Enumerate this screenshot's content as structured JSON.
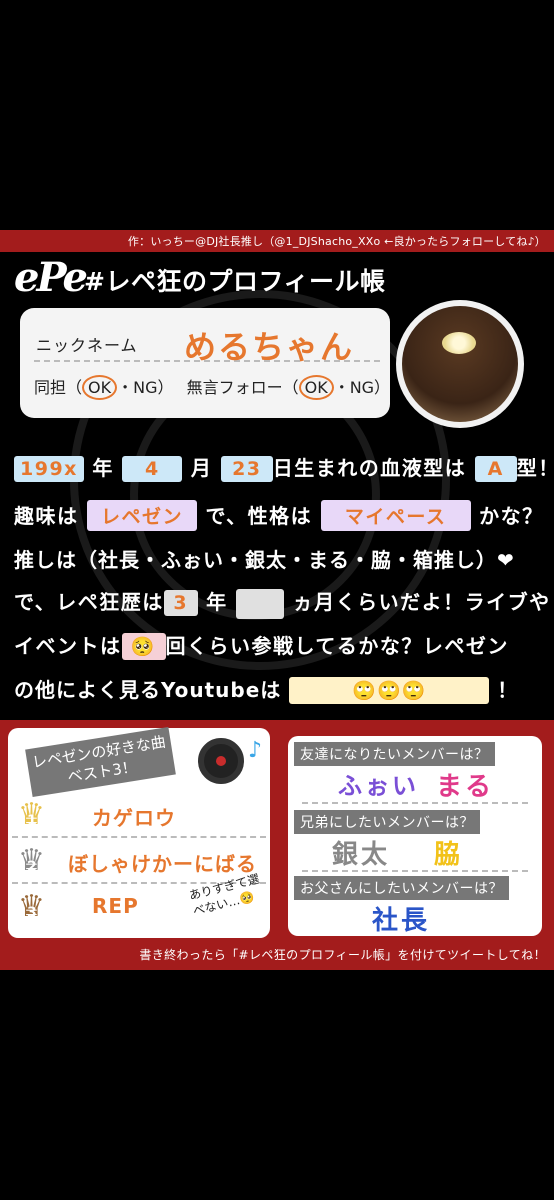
{
  "header": {
    "credit": "作：いっちー@DJ社長推し（@1_DJShacho_XXo ←良かったらフォローしてね♪）",
    "logo": "ePe",
    "title": "#レペ狂のプロフィール帳"
  },
  "profile": {
    "nickname_label": "ニックネーム",
    "nickname_value": "めるちゃん",
    "same_label": "同担（",
    "same_ok": "OK",
    "same_sep": "・NG）",
    "follow_label": "無言フォロー（",
    "follow_ok": "OK",
    "follow_sep": "・NG）"
  },
  "sentences": {
    "year": "199x",
    "year_suffix": "年",
    "month": "4",
    "month_suffix": "月",
    "day": "23",
    "day_suffix": "日生まれの血液型は",
    "blood": "A",
    "blood_suffix": "型！",
    "hobby_prefix": "趣味は",
    "hobby": "レペゼン",
    "hobby_mid": "で、性格は",
    "personality": "マイペース",
    "personality_suffix": "かな？",
    "oshi_line": "推しは（社長・ふぉい・銀太・まる・脇・箱推し）❤",
    "rp_prefix": "で、レペ狂歴は",
    "rp_years": "3",
    "rp_mid": "年",
    "rp_months": "",
    "rp_suffix": "ヵ月くらいだよ！ライブや",
    "event_prefix": "イベントは",
    "event_count": "🥺",
    "event_suffix": "回くらい参戦してるかな？レペゼン",
    "yt_prefix": "の他によく見るYoutubeは",
    "yt_value": "🙄🙄🙄",
    "yt_suffix": "！"
  },
  "best": {
    "tag": "レペゼンの好きな曲ベスト3！",
    "rank1": "1",
    "rank2": "2",
    "rank3": "3",
    "song1": "カゲロウ",
    "song2": "ぼしゃけかーにばる",
    "song3": "REP",
    "aside": "ありすぎて選べない…🥺"
  },
  "questions": {
    "q1": "友達になりたいメンバーは？",
    "a1a": "ふぉい",
    "a1b": "まる",
    "q2": "兄弟にしたいメンバーは？",
    "a2a": "銀太",
    "a2b": "脇",
    "q3": "お父さんにしたいメンバーは？",
    "a3": "社長"
  },
  "footer": "書き終わったら「#レペ狂のプロフィール帳」を付けてツイートしてね！",
  "colors": {
    "accent": "#e6772e",
    "red": "#a31c1c",
    "purple": "#7a4fd6",
    "pink": "#e03a8a",
    "blue": "#2a55c8",
    "grey": "#888888",
    "yellow": "#f2c21a"
  }
}
